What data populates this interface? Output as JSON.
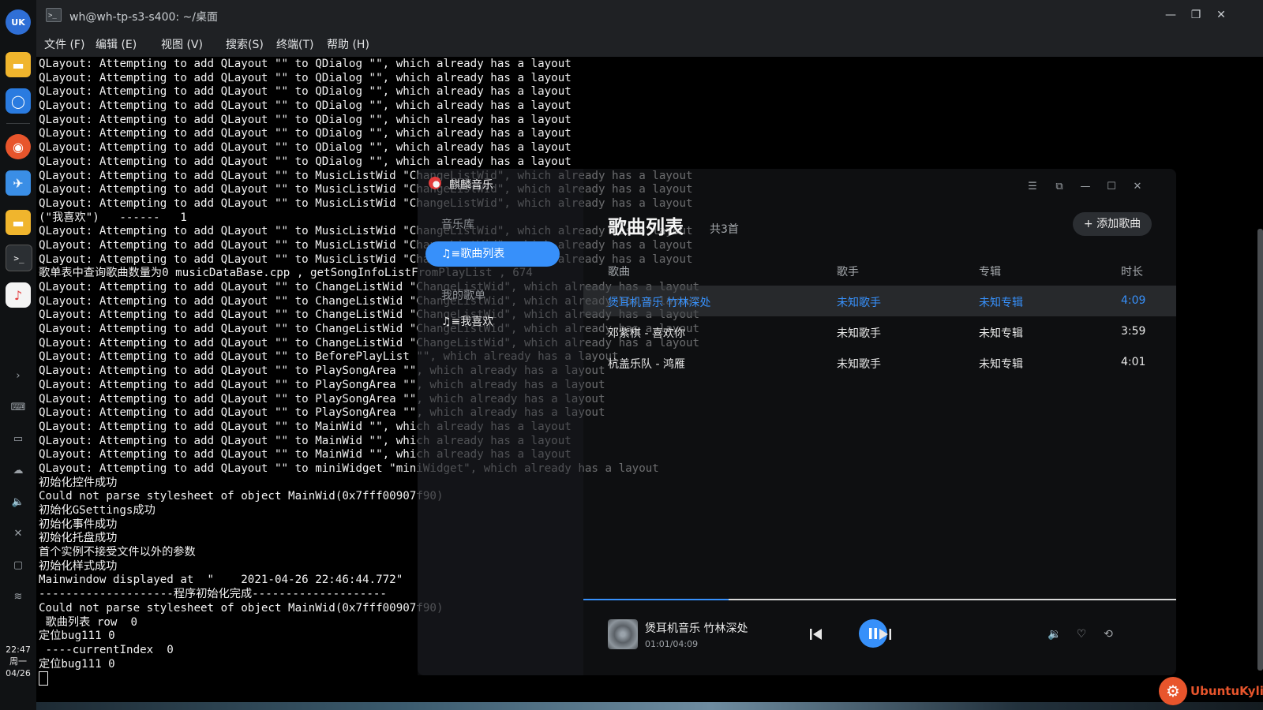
{
  "taskbar": {
    "time": "22:47",
    "weekday": "周一",
    "date": "04/26"
  },
  "terminal": {
    "title": "wh@wh-tp-s3-s400: ~/桌面",
    "menu": [
      "文件 (F)",
      "编辑 (E)",
      "视图 (V)",
      "搜索(S)",
      "终端(T)",
      "帮助 (H)"
    ],
    "lines": [
      "QLayout: Attempting to add QLayout \"\" to QDialog \"\", which already has a layout",
      "QLayout: Attempting to add QLayout \"\" to QDialog \"\", which already has a layout",
      "QLayout: Attempting to add QLayout \"\" to QDialog \"\", which already has a layout",
      "QLayout: Attempting to add QLayout \"\" to QDialog \"\", which already has a layout",
      "QLayout: Attempting to add QLayout \"\" to QDialog \"\", which already has a layout",
      "QLayout: Attempting to add QLayout \"\" to QDialog \"\", which already has a layout",
      "QLayout: Attempting to add QLayout \"\" to QDialog \"\", which already has a layout",
      "QLayout: Attempting to add QLayout \"\" to QDialog \"\", which already has a layout",
      "QLayout: Attempting to add QLayout \"\" to MusicListWid \"ChangeListWid\", which already has a layout",
      "QLayout: Attempting to add QLayout \"\" to MusicListWid \"ChangeListWid\", which already has a layout",
      "QLayout: Attempting to add QLayout \"\" to MusicListWid \"ChangeListWid\", which already has a layout",
      "(\"我喜欢\")   ------   1",
      "QLayout: Attempting to add QLayout \"\" to MusicListWid \"ChangeListWid\", which already has a layout",
      "QLayout: Attempting to add QLayout \"\" to MusicListWid \"ChangeListWid\", which already has a layout",
      "QLayout: Attempting to add QLayout \"\" to MusicListWid \"ChangeListWid\", which already has a layout",
      "歌单表中查询歌曲数量为0 musicDataBase.cpp , getSongInfoListFromPlayList , 674",
      "QLayout: Attempting to add QLayout \"\" to ChangeListWid \"ChangeListWid\", which already has a layout",
      "QLayout: Attempting to add QLayout \"\" to ChangeListWid \"ChangeListWid\", which already has a layout",
      "QLayout: Attempting to add QLayout \"\" to ChangeListWid \"ChangeListWid\", which already has a layout",
      "QLayout: Attempting to add QLayout \"\" to ChangeListWid \"ChangeListWid\", which already has a layout",
      "QLayout: Attempting to add QLayout \"\" to ChangeListWid \"ChangeListWid\", which already has a layout",
      "QLayout: Attempting to add QLayout \"\" to BeforePlayList \"\", which already has a layout",
      "QLayout: Attempting to add QLayout \"\" to PlaySongArea \"\", which already has a layout",
      "QLayout: Attempting to add QLayout \"\" to PlaySongArea \"\", which already has a layout",
      "QLayout: Attempting to add QLayout \"\" to PlaySongArea \"\", which already has a layout",
      "QLayout: Attempting to add QLayout \"\" to PlaySongArea \"\", which already has a layout",
      "QLayout: Attempting to add QLayout \"\" to MainWid \"\", which already has a layout",
      "QLayout: Attempting to add QLayout \"\" to MainWid \"\", which already has a layout",
      "QLayout: Attempting to add QLayout \"\" to MainWid \"\", which already has a layout",
      "QLayout: Attempting to add QLayout \"\" to miniWidget \"miniWidget\", which already has a layout",
      "初始化控件成功",
      "Could not parse stylesheet of object MainWid(0x7fff00907f90)",
      "初始化GSettings成功",
      "初始化事件成功",
      "初始化托盘成功",
      "首个实例不接受文件以外的参数",
      "初始化样式成功",
      "Mainwindow displayed at  \"    2021-04-26 22:46:44.772\"",
      "--------------------程序初始化完成--------------------",
      "Could not parse stylesheet of object MainWid(0x7fff00907f90)",
      " 歌曲列表 row  0",
      "定位bug111 0",
      " ----currentIndex  0",
      "定位bug111 0"
    ]
  },
  "music": {
    "app_name": "麒麟音乐",
    "section_library": "音乐库",
    "nav_song_list": "♫≡歌曲列表",
    "section_my_lists": "我的歌单",
    "nav_favorites": "♫≡我喜欢",
    "page_title": "歌曲列表",
    "song_count": "共3首",
    "add_button": "+ 添加歌曲",
    "headers": {
      "song": "歌曲",
      "artist": "歌手",
      "album": "专辑",
      "duration": "时长"
    },
    "songs": [
      {
        "title": "煲耳机音乐 竹林深处",
        "artist": "未知歌手",
        "album": "未知专辑",
        "duration": "4:09"
      },
      {
        "title": "邓紫棋 - 喜欢你",
        "artist": "未知歌手",
        "album": "未知专辑",
        "duration": "3:59"
      },
      {
        "title": "杭盖乐队 - 鸿雁",
        "artist": "未知歌手",
        "album": "未知专辑",
        "duration": "4:01"
      }
    ],
    "now_playing": {
      "title": "煲耳机音乐 竹林深处",
      "time": "01:01/04:09",
      "progress": 0.245
    },
    "accent_color": "#3790fa"
  },
  "brand": {
    "text": "UbuntuKylin",
    "color": "#e8552c"
  }
}
